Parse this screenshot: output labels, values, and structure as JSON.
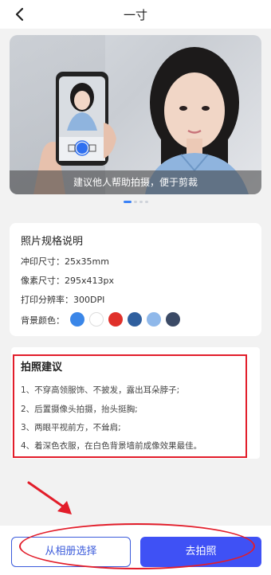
{
  "header": {
    "title": "一寸",
    "back_icon": "chevron-left-icon"
  },
  "banner": {
    "caption": "建议他人帮助拍摄，便于剪裁",
    "dots": 4,
    "active_dot": 0
  },
  "spec": {
    "title": "照片规格说明",
    "print_size": "冲印尺寸：25x35mm",
    "pixel_size": "像素尺寸：295x413px",
    "dpi": "打印分辨率：300DPI",
    "bg_label": "背景颜色：",
    "bg_colors": [
      "#3a86e8",
      "#ffffff",
      "#e0302a",
      "#2f5f9e",
      "#8fb8ea",
      "#3b4a66"
    ]
  },
  "tips": {
    "title": "拍照建议",
    "items": [
      "1、不穿高领服饰、不披发，露出耳朵脖子;",
      "2、后置摄像头拍摄，抬头挺胸;",
      "3、两眼平视前方，不耸肩;",
      "4、着深色衣服，在白色背景墙前成像效果最佳。"
    ]
  },
  "actions": {
    "album_label": "从相册选择",
    "shoot_label": "去拍照"
  }
}
